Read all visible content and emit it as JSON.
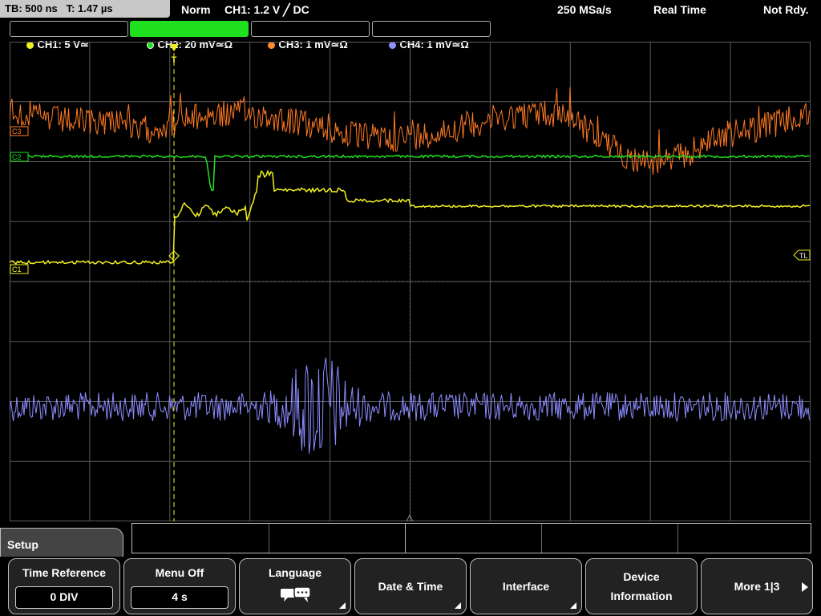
{
  "top": {
    "timebase": "TB: 500 ns   T: 1.47 µs",
    "mode": "Norm",
    "trigger": "CH1: 1.2 V ╱ DC",
    "sample_rate": "250 MSa/s",
    "acq": "Real Time",
    "state": "Not Rdy."
  },
  "channels": [
    {
      "label": "CH1: 5 V≃",
      "color": "#f0f020"
    },
    {
      "label": "CH2: 20 mV≃Ω",
      "color": "#20e020"
    },
    {
      "label": "CH3: 1 mV≃Ω",
      "color": "#ff8a2a"
    },
    {
      "label": "CH4: 1 mV≃Ω",
      "color": "#9090ff"
    }
  ],
  "markers": {
    "c3": "C3",
    "c2": "C2",
    "c1": "C1",
    "tl": "TL",
    "t": "T"
  },
  "softkeys": {
    "setup": "Setup",
    "time_reference": {
      "label": "Time Reference",
      "value": "0 DIV"
    },
    "menu_off": {
      "label": "Menu Off",
      "value": "4 s"
    },
    "language": {
      "label": "Language"
    },
    "date_time": "Date & Time",
    "interface": "Interface",
    "device_information": "Device Information",
    "more": "More 1|3"
  },
  "colors": {
    "grid": "#5a5a5a",
    "ch1": "#f0f020",
    "ch2": "#20e020",
    "ch3": "#ff7a22",
    "ch4": "#8c8cff"
  }
}
